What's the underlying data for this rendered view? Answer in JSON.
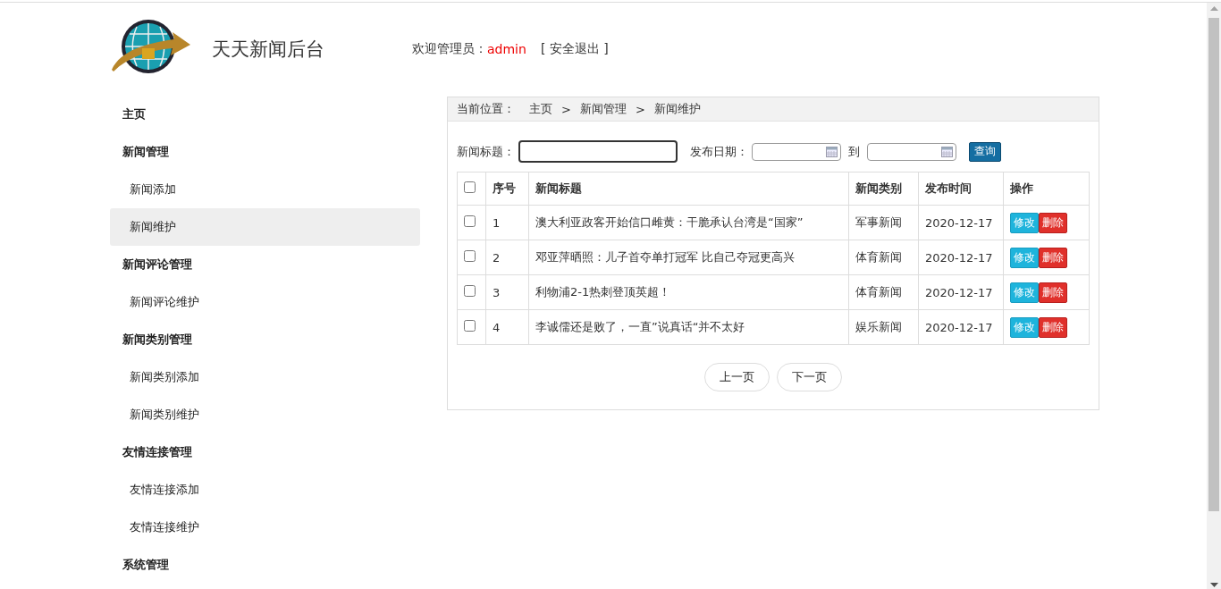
{
  "header": {
    "site_title": "天天新闻后台",
    "welcome_label": "欢迎管理员：",
    "username": "admin",
    "logout": "[ 安全退出 ]"
  },
  "sidebar": {
    "items": [
      {
        "label": "主页",
        "selected": false
      },
      {
        "label": "新闻管理",
        "selected": false,
        "children": [
          {
            "label": "新闻添加",
            "selected": false
          },
          {
            "label": "新闻维护",
            "selected": true
          }
        ]
      },
      {
        "label": "新闻评论管理",
        "selected": false,
        "children": [
          {
            "label": "新闻评论维护",
            "selected": false
          }
        ]
      },
      {
        "label": "新闻类别管理",
        "selected": false,
        "children": [
          {
            "label": "新闻类别添加",
            "selected": false
          },
          {
            "label": "新闻类别维护",
            "selected": false
          }
        ]
      },
      {
        "label": "友情连接管理",
        "selected": false,
        "children": [
          {
            "label": "友情连接添加",
            "selected": false
          },
          {
            "label": "友情连接维护",
            "selected": false
          }
        ]
      },
      {
        "label": "系统管理",
        "selected": false
      }
    ]
  },
  "breadcrumb": {
    "label": "当前位置：",
    "path": [
      "主页",
      "新闻管理",
      "新闻维护"
    ],
    "separator": ">"
  },
  "search": {
    "title_label": "新闻标题：",
    "date_label": "发布日期：",
    "to_label": "到",
    "button": "查询"
  },
  "table": {
    "columns": [
      "序号",
      "新闻标题",
      "新闻类别",
      "发布时间",
      "操作"
    ],
    "header_checked": false,
    "rows": [
      {
        "no": "1",
        "title": "澳大利亚政客开始信口雌黄：干脆承认台湾是“国家”",
        "category": "军事新闻",
        "date": "2020-12-17",
        "checked": false,
        "actions": [
          "修改",
          "删除"
        ]
      },
      {
        "no": "2",
        "title": "邓亚萍晒照：儿子首夺单打冠军 比自己夺冠更高兴",
        "category": "体育新闻",
        "date": "2020-12-17",
        "checked": false,
        "actions": [
          "修改",
          "删除"
        ]
      },
      {
        "no": "3",
        "title": "利物浦2-1热刺登顶英超！",
        "category": "体育新闻",
        "date": "2020-12-17",
        "checked": false,
        "actions": [
          "修改",
          "删除"
        ]
      },
      {
        "no": "4",
        "title": "李诚儒还是败了，一直”说真话“并不太好",
        "category": "娱乐新闻",
        "date": "2020-12-17",
        "checked": false,
        "actions": [
          "修改",
          "删除"
        ]
      }
    ]
  },
  "pagination": [
    "上一页",
    "下一页"
  ]
}
